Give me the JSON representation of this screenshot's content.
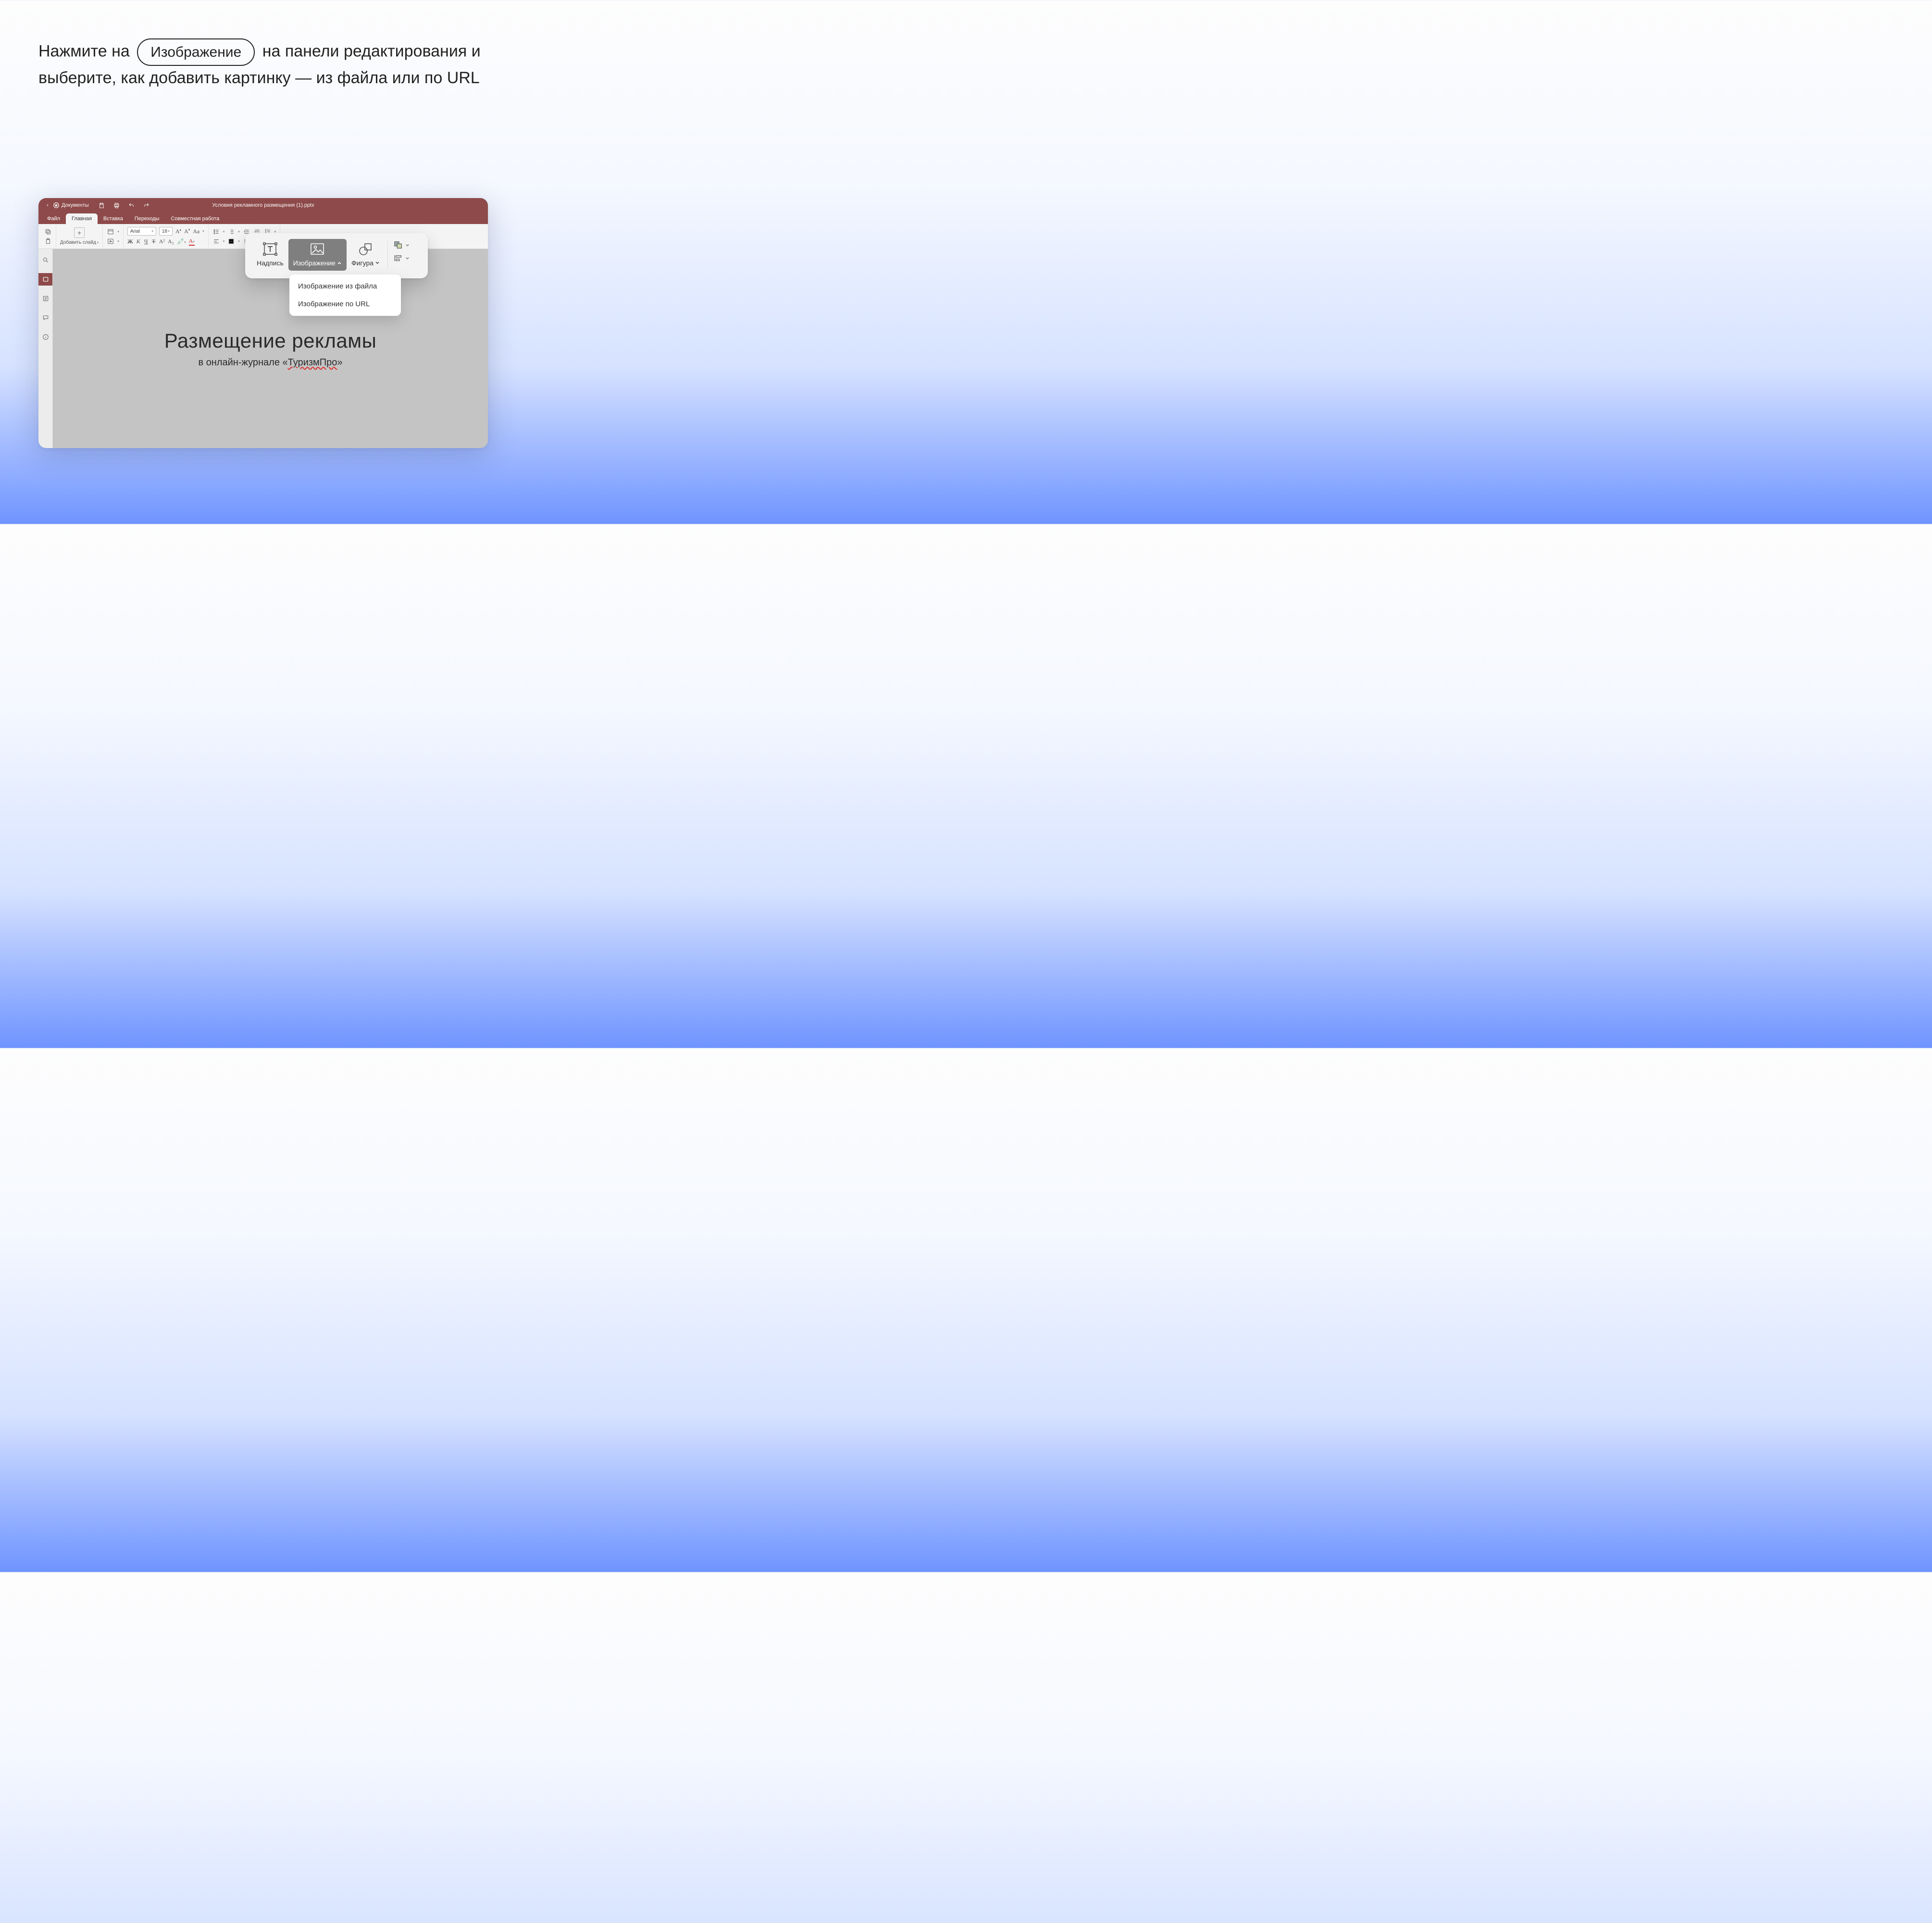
{
  "instruction": {
    "part1": "Нажмите на",
    "pill": "Изображение",
    "part2": "на панели редактирования и выберите, как добавить картинку — из файла или по URL"
  },
  "titlebar": {
    "app_name": "Документы",
    "doc_title": "Условия рекламного размещения (1).pptx"
  },
  "tabs": {
    "file": "Файл",
    "main": "Главная",
    "insert": "Вставка",
    "transitions": "Переходы",
    "collab": "Совместная работа"
  },
  "ribbon": {
    "add_slide": "Добавить слайд",
    "font_name": "Arial",
    "font_size": "18"
  },
  "slide": {
    "title": "Размещение рекламы",
    "subtitle_prefix": "в онлайн-журнале «",
    "subtitle_spell": "ТуризмПро",
    "subtitle_suffix": "»"
  },
  "popover": {
    "caption": "Надпись",
    "image": "Изображение",
    "shape": "Фигура"
  },
  "dropdown": {
    "from_file": "Изображение из файла",
    "from_url": "Изображение по URL"
  }
}
